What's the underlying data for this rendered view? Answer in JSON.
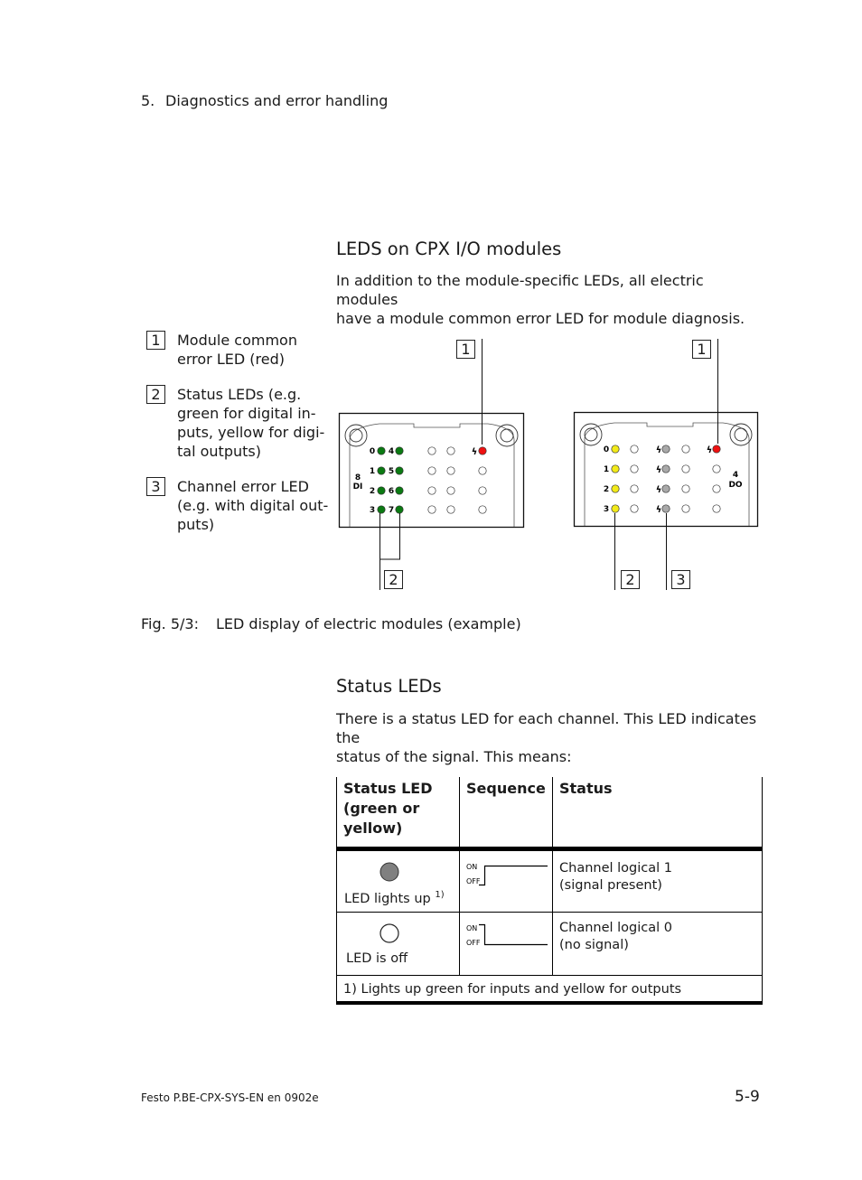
{
  "header": {
    "chapter_number": "5.",
    "chapter_title": "Diagnostics and error handling"
  },
  "section1": {
    "heading": "LEDS on CPX I/O modules",
    "body_line1": "In addition to the module-specific LEDs, all electric modules",
    "body_line2": "have a module common error LED for module diagnosis."
  },
  "legend": [
    {
      "number": "1",
      "lines": [
        "Module common",
        "error LED (red)"
      ]
    },
    {
      "number": "2",
      "lines": [
        "Status LEDs (e.g.",
        "green for digital in-",
        "puts, yellow for digi-",
        "tal outputs)"
      ]
    },
    {
      "number": "3",
      "lines": [
        "Channel error LED",
        "(e.g. with digital out-",
        "puts)"
      ]
    }
  ],
  "figure": {
    "module_di": {
      "type_label_top": "8",
      "type_label_bottom": "DI",
      "channel_labels_left": [
        "0",
        "1",
        "2",
        "3"
      ],
      "channel_labels_right": [
        "4",
        "5",
        "6",
        "7"
      ],
      "status_led_color": "#0b7a12",
      "error_led_color": "#ee1111",
      "error_symbol": "ϟ",
      "callouts": [
        "1",
        "2"
      ]
    },
    "module_do": {
      "type_label_top": "4",
      "type_label_bottom": "DO",
      "channel_labels": [
        "0",
        "1",
        "2",
        "3"
      ],
      "status_led_color": "#f2ea1a",
      "channel_error_led_color": "#a9a9a9",
      "error_led_color": "#ee1111",
      "error_symbol": "ϟ",
      "callouts": [
        "1",
        "2",
        "3"
      ]
    },
    "caption_label": "Fig. 5/3:",
    "caption_text": "LED display of electric modules (example)"
  },
  "section2": {
    "heading": "Status LEDs",
    "body_line1": "There is a status LED for each channel. This LED indicates the",
    "body_line2": "status of the signal. This means:"
  },
  "table": {
    "headers": {
      "col1_line1": "Status LED",
      "col1_line2": "(green or",
      "col1_line3": "yellow)",
      "col2": "Sequence",
      "col3": "Status"
    },
    "rows": [
      {
        "led_label": "LED lights up",
        "led_footnote": "1)",
        "led_state": "on",
        "seq_on": "ON",
        "seq_off": "OFF",
        "status_line1": "Channel logical 1",
        "status_line2": "(signal present)"
      },
      {
        "led_label": "LED is off",
        "led_footnote": "",
        "led_state": "off",
        "seq_on": "ON",
        "seq_off": "OFF",
        "status_line1": "Channel logical 0",
        "status_line2": "(no signal)"
      }
    ],
    "footnote": "1) Lights up green for inputs and yellow for outputs",
    "led_on_color": "#808080"
  },
  "footer": {
    "document_id": "Festo P.BE-CPX-SYS-EN  en 0902e",
    "page_number": "5-9"
  }
}
